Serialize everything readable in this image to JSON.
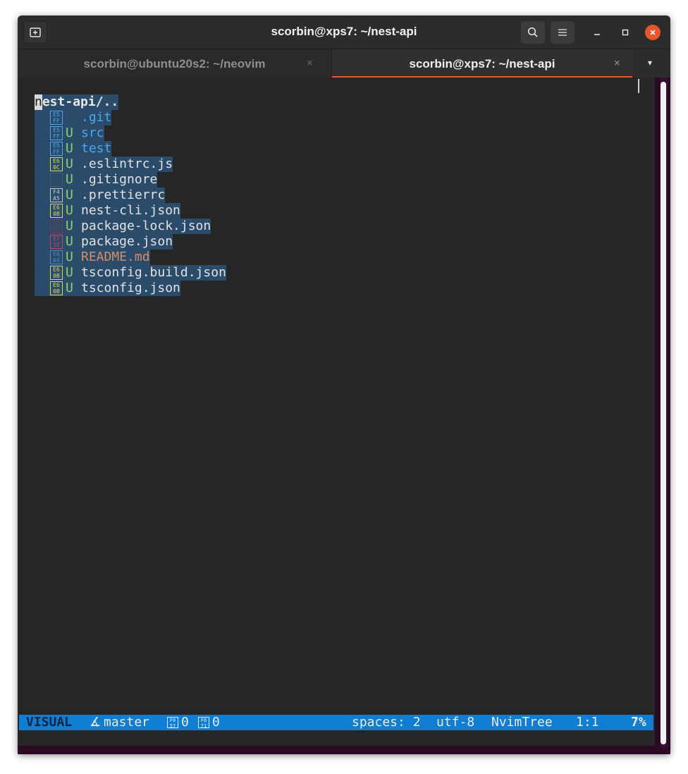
{
  "window": {
    "title": "scorbin@xps7: ~/nest-api",
    "tabs": [
      {
        "label": "scorbin@ubuntu20s2: ~/neovim",
        "active": false
      },
      {
        "label": "scorbin@xps7: ~/nest-api",
        "active": true
      }
    ],
    "icons": {
      "new_tab": "new-tab-icon",
      "search": "search-icon",
      "menu": "hamburger-menu-icon",
      "minimize": "minimize-icon",
      "maximize": "maximize-icon",
      "close": "close-icon",
      "tab_close": "×",
      "tab_dropdown": "▾"
    }
  },
  "tree": {
    "root": {
      "first_char": "n",
      "rest": "est-api/.."
    },
    "entries": [
      {
        "glyph": "E5\nFF",
        "status": "",
        "name": ".git",
        "kind": "dir",
        "glyph_color": "#4aa8f0"
      },
      {
        "glyph": "E5\nFF",
        "status": "U",
        "name": "src",
        "kind": "dir",
        "glyph_color": "#4aa8f0"
      },
      {
        "glyph": "E5\nFF",
        "status": "U",
        "name": "test",
        "kind": "dir",
        "glyph_color": "#4aa8f0"
      },
      {
        "glyph": "E6\n0C",
        "status": "U",
        "name": ".eslintrc.js",
        "kind": "file",
        "glyph_color": "#d8d85a"
      },
      {
        "glyph": "",
        "status": "U",
        "name": ".gitignore",
        "kind": "file",
        "glyph_color": "#3e5a77"
      },
      {
        "glyph": "F4\nA5",
        "status": "U",
        "name": ".prettierrc",
        "kind": "file",
        "glyph_color": "#c8c8c8"
      },
      {
        "glyph": "E6\n0B",
        "status": "U",
        "name": "nest-cli.json",
        "kind": "file",
        "glyph_color": "#d8d85a"
      },
      {
        "glyph": "E7\n1E",
        "status": "U",
        "name": "package-lock.json",
        "kind": "file",
        "glyph_color": "#7a3a4a"
      },
      {
        "glyph": "E7\n1E",
        "status": "U",
        "name": "package.json",
        "kind": "file",
        "glyph_color": "#d04060"
      },
      {
        "glyph": "E6\n09",
        "status": "U",
        "name": "README.md",
        "kind": "readme",
        "glyph_color": "#4a8ac0"
      },
      {
        "glyph": "E6\n0B",
        "status": "U",
        "name": "tsconfig.build.json",
        "kind": "file",
        "glyph_color": "#d8d85a"
      },
      {
        "glyph": "E6\n0B",
        "status": "U",
        "name": "tsconfig.json",
        "kind": "file",
        "glyph_color": "#d8d85a"
      }
    ]
  },
  "statusline": {
    "mode": "VISUAL",
    "branch_icon": "∡",
    "branch": "master",
    "error_glyph": "F0\n57",
    "error_count": "0",
    "warning_glyph": "F0\n71",
    "warning_count": "0",
    "indent": "spaces: 2",
    "encoding": "utf-8",
    "filetype": "NvimTree",
    "position": "1:1",
    "percent": "7%"
  },
  "colors": {
    "statusline_bg": "#0f7dd1",
    "selection_bg": "#2b4b6b",
    "tab_accent": "#e9542a",
    "git_untracked": "#8fd16a",
    "directory": "#4aa8f0",
    "readme": "#d58d68"
  }
}
